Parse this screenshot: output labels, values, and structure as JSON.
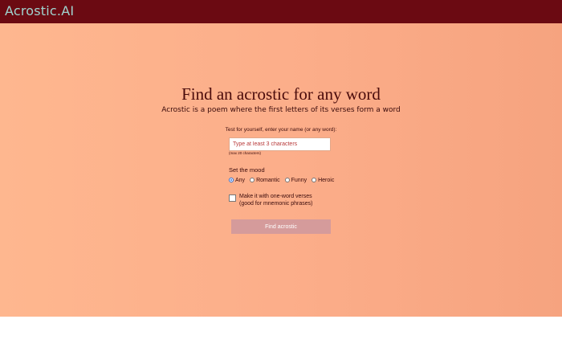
{
  "header": {
    "logo": "Acrostic.AI",
    "background": "#6b0a12",
    "logo_color": "#9fd4cf"
  },
  "hero": {
    "title": "Find an acrostic for any word",
    "subtitle": "Acrostic is a poem where the first letters of its verses form a word",
    "gradient": [
      "#feb78f",
      "#f6a37f"
    ]
  },
  "form": {
    "prompt": "Test for yourself, enter your name (or any word):",
    "name_input": {
      "value": "",
      "placeholder": "Type at least 3 characters"
    },
    "max_hint": "(max 20 characters)",
    "mood_label": "Set the mood",
    "moods": [
      {
        "label": "Any",
        "selected": true
      },
      {
        "label": "Romantic",
        "selected": false
      },
      {
        "label": "Funny",
        "selected": false
      },
      {
        "label": "Heroic",
        "selected": false
      }
    ],
    "one_word": {
      "checked": false,
      "line1": "Make it with one-word verses",
      "line2": "(good for mnemonic phrases)"
    },
    "submit_label": "Find acrostic"
  }
}
